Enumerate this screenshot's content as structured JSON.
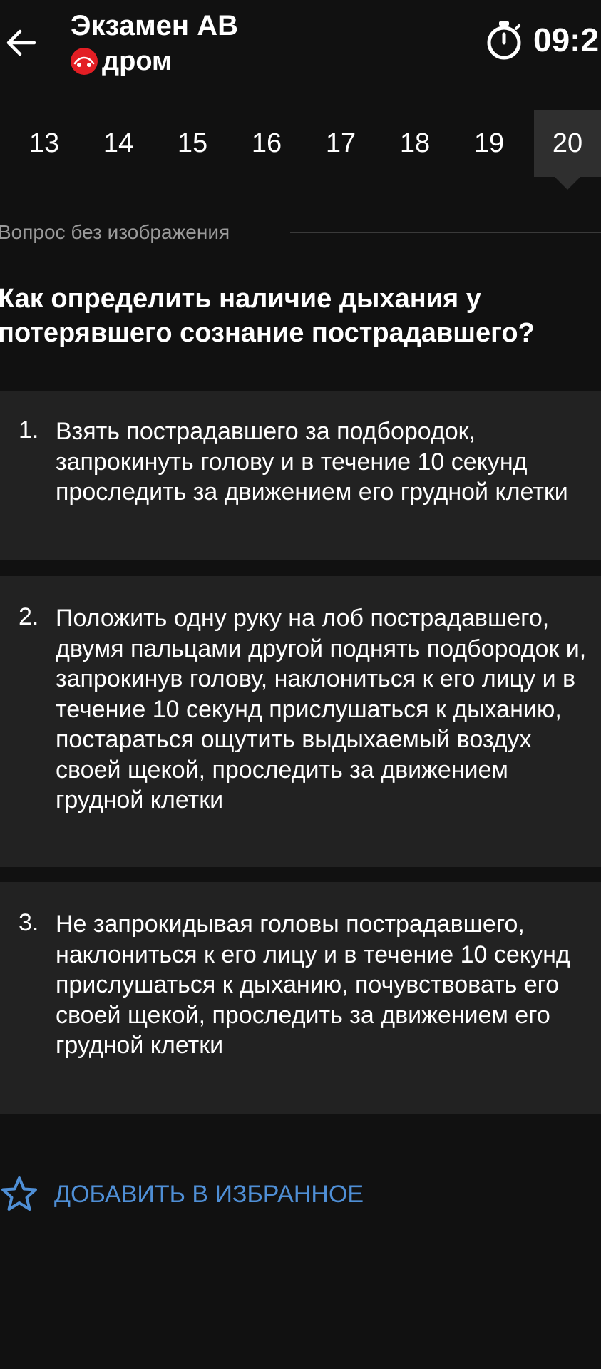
{
  "header": {
    "title": "Экзамен АВ",
    "brand_name": "дром",
    "timer": "09:2",
    "brand_color": "#e31e24"
  },
  "tabs": [
    "13",
    "14",
    "15",
    "16",
    "17",
    "18",
    "19",
    "20"
  ],
  "active_tab": "20",
  "question": {
    "label": "Вопрос без изображения",
    "text": "Как определить наличие дыхания у потерявшего сознание пострадавшего?"
  },
  "answers": [
    {
      "number": "1.",
      "text": "Взять пострадавшего за подбородок, запрокинуть голову и в течение 10 секунд проследить за движением его грудной клетки"
    },
    {
      "number": "2.",
      "text": "Положить одну руку на лоб пострадавшего, двумя пальцами другой поднять подбородок и, запрокинув голову, наклониться к его лицу и в течение 10 секунд прислушаться к дыханию, постараться ощутить выдыхаемый воздух своей щекой, проследить за движением грудной клетки"
    },
    {
      "number": "3.",
      "text": "Не запрокидывая головы пострадавшего, наклониться к его лицу и в течение 10 секунд прислушаться к дыханию, почувствовать его своей щекой, проследить за движением его грудной клетки"
    }
  ],
  "favorite": {
    "label": "ДОБАВИТЬ В ИЗБРАННОЕ",
    "color": "#4f8fd6"
  },
  "icons": {
    "back": "arrow-left-icon",
    "timer": "stopwatch-icon",
    "brand": "drom-logo-icon",
    "favorite": "star-outline-icon"
  }
}
